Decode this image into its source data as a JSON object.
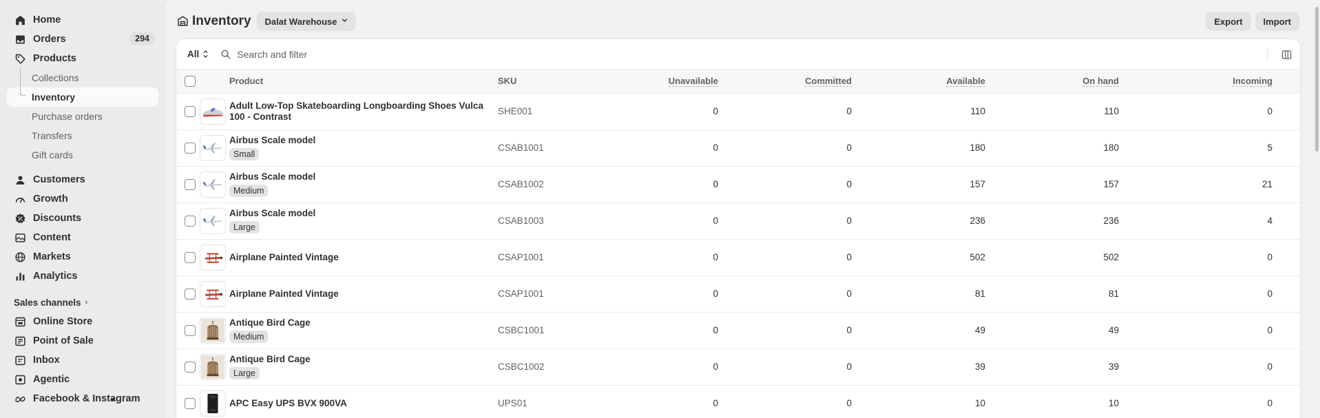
{
  "sidebar": {
    "items": [
      {
        "label": "Home",
        "icon": "home-icon"
      },
      {
        "label": "Orders",
        "icon": "inbox-tray-icon",
        "badge": "294"
      },
      {
        "label": "Products",
        "icon": "tag-icon"
      }
    ],
    "sub_items": [
      "Collections",
      "Inventory",
      "Purchase orders",
      "Transfers",
      "Gift cards"
    ],
    "items2": [
      {
        "label": "Customers",
        "icon": "person-icon"
      },
      {
        "label": "Growth",
        "icon": "gauge-icon"
      },
      {
        "label": "Discounts",
        "icon": "discount-badge-icon"
      },
      {
        "label": "Content",
        "icon": "content-icon"
      },
      {
        "label": "Markets",
        "icon": "globe-icon"
      },
      {
        "label": "Analytics",
        "icon": "bar-chart-icon"
      }
    ],
    "sales_channels_label": "Sales channels",
    "channels": [
      {
        "label": "Online Store",
        "icon": "store-icon"
      },
      {
        "label": "Point of Sale",
        "icon": "pos-icon"
      },
      {
        "label": "Inbox",
        "icon": "chat-icon"
      },
      {
        "label": "Agentic",
        "icon": "agentic-icon"
      },
      {
        "label": "Facebook & Instagram",
        "icon": "meta-icon"
      }
    ]
  },
  "header": {
    "title": "Inventory",
    "location": "Dalat Warehouse",
    "export_label": "Export",
    "import_label": "Import"
  },
  "filter": {
    "all_label": "All",
    "search_placeholder": "Search and filter"
  },
  "table": {
    "columns": {
      "product": "Product",
      "sku": "SKU",
      "unavailable": "Unavailable",
      "committed": "Committed",
      "available": "Available",
      "on_hand": "On hand",
      "incoming": "Incoming"
    },
    "rows": [
      {
        "name": "Adult Low-Top Skateboarding Longboarding Shoes Vulca 100 - Contrast",
        "variant": "",
        "sku": "SHE001",
        "unavailable": "0",
        "committed": "0",
        "available": "110",
        "on_hand": "110",
        "incoming": "0",
        "thumb": "shoe"
      },
      {
        "name": "Airbus Scale model",
        "variant": "Small",
        "sku": "CSAB1001",
        "unavailable": "0",
        "committed": "0",
        "available": "180",
        "on_hand": "180",
        "incoming": "5",
        "thumb": "plane"
      },
      {
        "name": "Airbus Scale model",
        "variant": "Medium",
        "sku": "CSAB1002",
        "unavailable": "0",
        "committed": "0",
        "available": "157",
        "on_hand": "157",
        "incoming": "21",
        "thumb": "plane"
      },
      {
        "name": "Airbus Scale model",
        "variant": "Large",
        "sku": "CSAB1003",
        "unavailable": "0",
        "committed": "0",
        "available": "236",
        "on_hand": "236",
        "incoming": "4",
        "thumb": "plane"
      },
      {
        "name": "Airplane Painted Vintage",
        "variant": "",
        "sku": "CSAP1001",
        "unavailable": "0",
        "committed": "0",
        "available": "502",
        "on_hand": "502",
        "incoming": "0",
        "thumb": "biplane"
      },
      {
        "name": "Airplane Painted Vintage",
        "variant": "",
        "sku": "CSAP1001",
        "unavailable": "0",
        "committed": "0",
        "available": "81",
        "on_hand": "81",
        "incoming": "0",
        "thumb": "biplane"
      },
      {
        "name": "Antique Bird Cage",
        "variant": "Medium",
        "sku": "CSBC1001",
        "unavailable": "0",
        "committed": "0",
        "available": "49",
        "on_hand": "49",
        "incoming": "0",
        "thumb": "cage"
      },
      {
        "name": "Antique Bird Cage",
        "variant": "Large",
        "sku": "CSBC1002",
        "unavailable": "0",
        "committed": "0",
        "available": "39",
        "on_hand": "39",
        "incoming": "0",
        "thumb": "cage"
      },
      {
        "name": "APC Easy UPS BVX 900VA",
        "variant": "",
        "sku": "UPS01",
        "unavailable": "0",
        "committed": "0",
        "available": "10",
        "on_hand": "10",
        "incoming": "0",
        "thumb": "ups"
      }
    ]
  }
}
